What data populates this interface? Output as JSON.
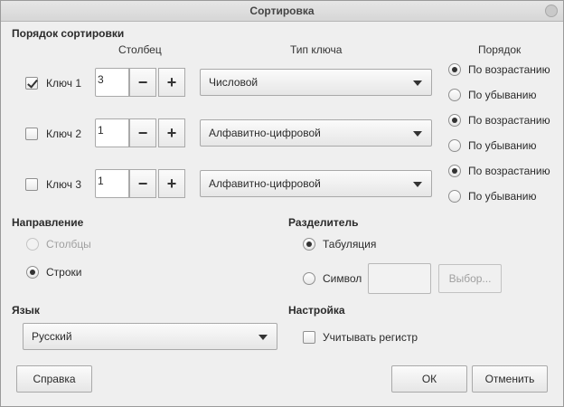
{
  "window": {
    "title": "Сортировка"
  },
  "sort_order": {
    "heading": "Порядок сортировки",
    "col_column": "Столбец",
    "col_key_type": "Тип ключа",
    "col_order": "Порядок",
    "keys": [
      {
        "label": "Ключ 1",
        "checked": true,
        "column": "3",
        "type": "Числовой",
        "asc": "По возрастанию",
        "desc": "По убыванию"
      },
      {
        "label": "Ключ 2",
        "checked": false,
        "column": "1",
        "type": "Алфавитно-цифровой",
        "asc": "По возрастанию",
        "desc": "По убыванию"
      },
      {
        "label": "Ключ 3",
        "checked": false,
        "column": "1",
        "type": "Алфавитно-цифровой",
        "asc": "По возрастанию",
        "desc": "По убыванию"
      }
    ],
    "minus": "−",
    "plus": "+"
  },
  "direction": {
    "heading": "Направление",
    "columns": "Столбцы",
    "rows": "Строки"
  },
  "separator": {
    "heading": "Разделитель",
    "tab": "Табуляция",
    "symbol": "Символ",
    "choose": "Выбор..."
  },
  "language": {
    "heading": "Язык",
    "value": "Русский"
  },
  "settings": {
    "heading": "Настройка",
    "case_sensitive": "Учитывать регистр"
  },
  "footer": {
    "help": "Справка",
    "ok": "ОК",
    "cancel": "Отменить"
  }
}
